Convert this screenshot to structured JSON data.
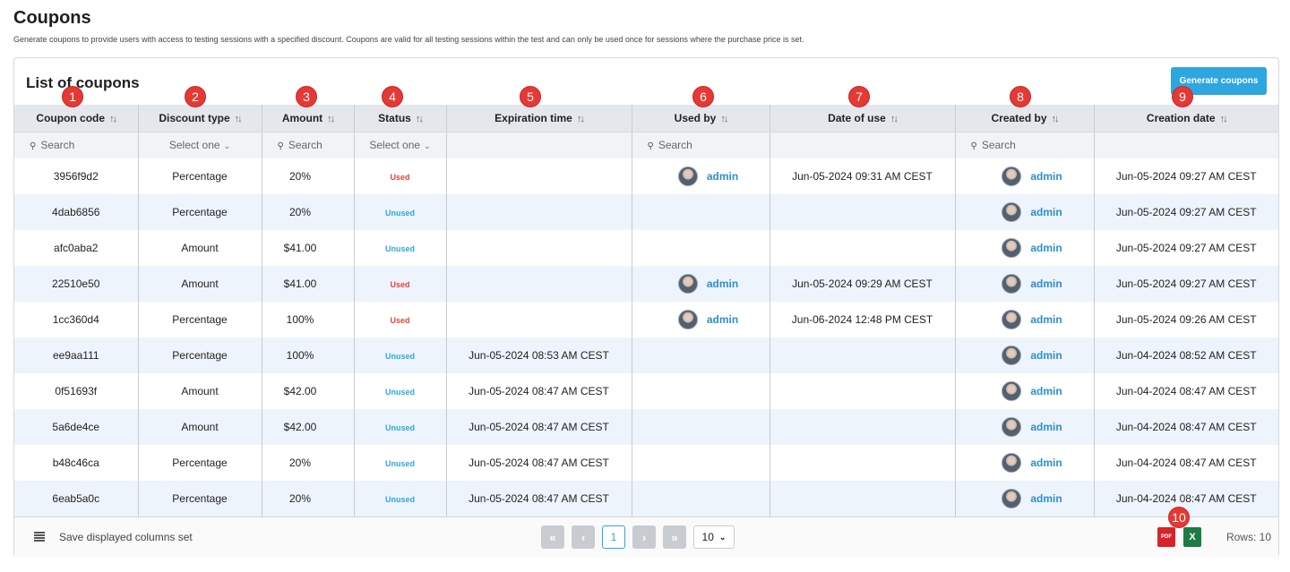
{
  "page": {
    "title": "Coupons",
    "description": "Generate coupons to provide users with access to testing sessions with a specified discount. Coupons are valid for all testing sessions within the test and can only be used once for sessions where the purchase price is set."
  },
  "card": {
    "title": "List of coupons",
    "generate_label": "Generate coupons"
  },
  "columns": [
    "Coupon code",
    "Discount type",
    "Amount",
    "Status",
    "Expiration time",
    "Used by",
    "Date of use",
    "Created by",
    "Creation date"
  ],
  "sort_icon": "↑↓",
  "filters": {
    "search_placeholder": "Search",
    "select_placeholder": "Select one"
  },
  "rows": [
    {
      "code": "3956f9d2",
      "type": "Percentage",
      "amount": "20%",
      "status": "Used",
      "expiration": "",
      "used_by": "admin",
      "date_of_use": "Jun-05-2024 09:31 AM CEST",
      "created_by": "admin",
      "creation_date": "Jun-05-2024 09:27 AM CEST"
    },
    {
      "code": "4dab6856",
      "type": "Percentage",
      "amount": "20%",
      "status": "Unused",
      "expiration": "",
      "used_by": "",
      "date_of_use": "",
      "created_by": "admin",
      "creation_date": "Jun-05-2024 09:27 AM CEST"
    },
    {
      "code": "afc0aba2",
      "type": "Amount",
      "amount": "$41.00",
      "status": "Unused",
      "expiration": "",
      "used_by": "",
      "date_of_use": "",
      "created_by": "admin",
      "creation_date": "Jun-05-2024 09:27 AM CEST"
    },
    {
      "code": "22510e50",
      "type": "Amount",
      "amount": "$41.00",
      "status": "Used",
      "expiration": "",
      "used_by": "admin",
      "date_of_use": "Jun-05-2024 09:29 AM CEST",
      "created_by": "admin",
      "creation_date": "Jun-05-2024 09:27 AM CEST"
    },
    {
      "code": "1cc360d4",
      "type": "Percentage",
      "amount": "100%",
      "status": "Used",
      "expiration": "",
      "used_by": "admin",
      "date_of_use": "Jun-06-2024 12:48 PM CEST",
      "created_by": "admin",
      "creation_date": "Jun-05-2024 09:26 AM CEST"
    },
    {
      "code": "ee9aa111",
      "type": "Percentage",
      "amount": "100%",
      "status": "Unused",
      "expiration": "Jun-05-2024 08:53 AM CEST",
      "used_by": "",
      "date_of_use": "",
      "created_by": "admin",
      "creation_date": "Jun-04-2024 08:52 AM CEST"
    },
    {
      "code": "0f51693f",
      "type": "Amount",
      "amount": "$42.00",
      "status": "Unused",
      "expiration": "Jun-05-2024 08:47 AM CEST",
      "used_by": "",
      "date_of_use": "",
      "created_by": "admin",
      "creation_date": "Jun-04-2024 08:47 AM CEST"
    },
    {
      "code": "5a6de4ce",
      "type": "Amount",
      "amount": "$42.00",
      "status": "Unused",
      "expiration": "Jun-05-2024 08:47 AM CEST",
      "used_by": "",
      "date_of_use": "",
      "created_by": "admin",
      "creation_date": "Jun-04-2024 08:47 AM CEST"
    },
    {
      "code": "b48c46ca",
      "type": "Percentage",
      "amount": "20%",
      "status": "Unused",
      "expiration": "Jun-05-2024 08:47 AM CEST",
      "used_by": "",
      "date_of_use": "",
      "created_by": "admin",
      "creation_date": "Jun-04-2024 08:47 AM CEST"
    },
    {
      "code": "6eab5a0c",
      "type": "Percentage",
      "amount": "20%",
      "status": "Unused",
      "expiration": "Jun-05-2024 08:47 AM CEST",
      "used_by": "",
      "date_of_use": "",
      "created_by": "admin",
      "creation_date": "Jun-04-2024 08:47 AM CEST"
    }
  ],
  "footer": {
    "save_columns_label": "Save displayed columns set",
    "first_icon": "«",
    "prev_icon": "‹",
    "next_icon": "›",
    "last_icon": "»",
    "current_page": "1",
    "page_size": "10",
    "pdf_label": "PDF",
    "xls_label": "X",
    "rows_label": "Rows: 10"
  },
  "markers": [
    "1",
    "2",
    "3",
    "4",
    "5",
    "6",
    "7",
    "8",
    "9",
    "10"
  ],
  "colors": {
    "accent": "#2ea6e0",
    "used": "#e0433c",
    "marker": "#e53935"
  },
  "icons": {
    "search": "search-icon",
    "menu": "menu-icon",
    "pdf": "pdf-export-icon",
    "excel": "excel-export-icon"
  }
}
